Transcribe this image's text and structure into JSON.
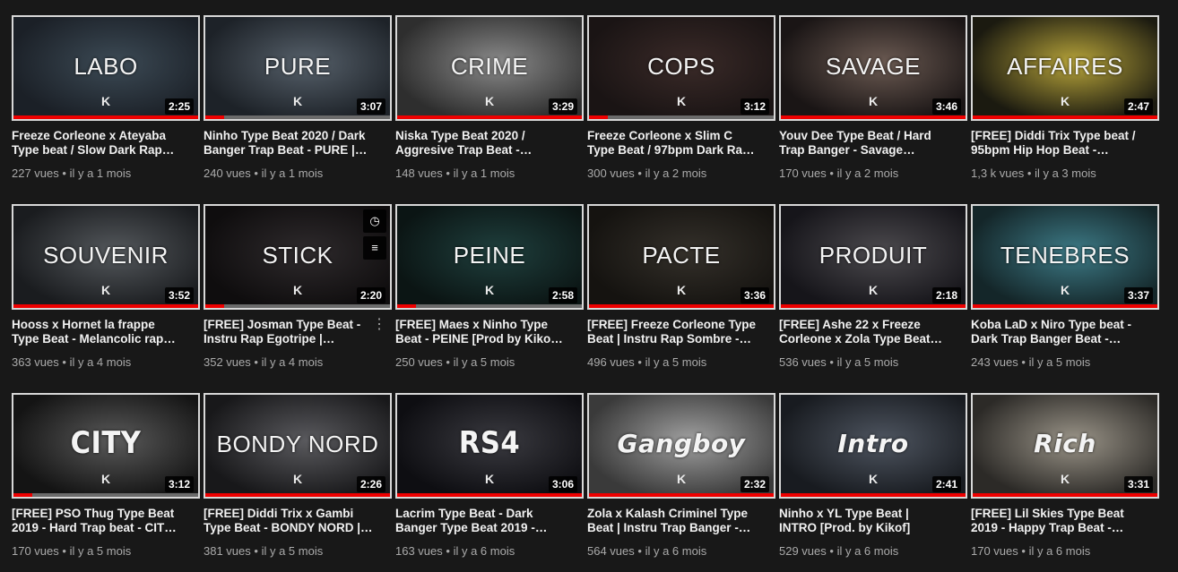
{
  "videos": [
    {
      "thumb_text": "LABO",
      "duration": "2:25",
      "title": "Freeze Corleone x Ateyaba Type beat / Slow Dark Rap…",
      "views": "227 vues",
      "age": "il y a 1 mois",
      "progress": 1.0,
      "thumb_style": "thin"
    },
    {
      "thumb_text": "PURE",
      "duration": "3:07",
      "title": "Ninho Type Beat 2020 / Dark Banger Trap Beat - PURE |…",
      "views": "240 vues",
      "age": "il y a 1 mois",
      "progress": 0.1,
      "thumb_style": "thin"
    },
    {
      "thumb_text": "CRIME",
      "duration": "3:29",
      "title": "Niska Type Beat 2020 / Aggresive Trap Beat - CRIM…",
      "views": "148 vues",
      "age": "il y a 1 mois",
      "progress": 1.0,
      "thumb_style": "thin"
    },
    {
      "thumb_text": "COPS",
      "duration": "3:12",
      "title": "Freeze Corleone x Slim C Type Beat / 97bpm Dark Ra…",
      "views": "300 vues",
      "age": "il y a 2 mois",
      "progress": 0.1,
      "thumb_style": "thin"
    },
    {
      "thumb_text": "SAVAGE",
      "duration": "3:46",
      "title": "Youv Dee Type Beat / Hard Trap Banger - Savage [Prod…",
      "views": "170 vues",
      "age": "il y a 2 mois",
      "progress": 1.0,
      "thumb_style": "thin"
    },
    {
      "thumb_text": "AFFAIRES",
      "duration": "2:47",
      "title": "[FREE] Diddi Trix Type beat / 95bpm Hip Hop Beat -…",
      "views": "1,3 k vues",
      "age": "il y a 3 mois",
      "progress": 1.0,
      "thumb_style": "thin"
    },
    {
      "thumb_text": "SOUVENIR",
      "duration": "3:52",
      "title": "Hooss x Hornet la frappe Type Beat - Melancolic rap…",
      "views": "363 vues",
      "age": "il y a 4 mois",
      "progress": 1.0,
      "thumb_style": "thin"
    },
    {
      "thumb_text": "STICK",
      "duration": "2:20",
      "title": "[FREE] Josman Type Beat - Instru Rap Egotripe | STICK…",
      "views": "352 vues",
      "age": "il y a 4 mois",
      "progress": 0.1,
      "thumb_style": "thin",
      "hovered": true
    },
    {
      "thumb_text": "PEINE",
      "duration": "2:58",
      "title": "[FREE] Maes x Ninho Type Beat - PEINE [Prod by Kikof …",
      "views": "250 vues",
      "age": "il y a 5 mois",
      "progress": 0.1,
      "thumb_style": "thin"
    },
    {
      "thumb_text": "PACTE",
      "duration": "3:36",
      "title": "[FREE] Freeze Corleone Type Beat | Instru Rap Sombre -…",
      "views": "496 vues",
      "age": "il y a 5 mois",
      "progress": 1.0,
      "thumb_style": "thin"
    },
    {
      "thumb_text": "PRODUIT",
      "duration": "2:18",
      "title": "[FREE] Ashe 22 x Freeze Corleone x Zola Type Beat -…",
      "views": "536 vues",
      "age": "il y a 5 mois",
      "progress": 1.0,
      "thumb_style": "thin"
    },
    {
      "thumb_text": "TENEBRES",
      "duration": "3:37",
      "title": "Koba LaD x Niro Type beat - Dark Trap Banger Beat -…",
      "views": "243 vues",
      "age": "il y a 5 mois",
      "progress": 1.0,
      "thumb_style": "thin"
    },
    {
      "thumb_text": "CITY",
      "duration": "3:12",
      "title": "[FREE] PSO Thug Type Beat 2019 - Hard Trap beat - CIT…",
      "views": "170 vues",
      "age": "il y a 5 mois",
      "progress": 0.1,
      "thumb_style": "bold"
    },
    {
      "thumb_text": "BONDY NORD",
      "duration": "2:26",
      "title": "[FREE] Diddi Trix x Gambi Type Beat - BONDY NORD |…",
      "views": "381 vues",
      "age": "il y a 5 mois",
      "progress": 1.0,
      "thumb_style": "thin"
    },
    {
      "thumb_text": "RS4",
      "duration": "3:06",
      "title": "Lacrim Type Beat - Dark Banger Type Beat 2019 - RS…",
      "views": "163 vues",
      "age": "il y a 6 mois",
      "progress": 1.0,
      "thumb_style": "bold"
    },
    {
      "thumb_text": "Gangboy",
      "duration": "2:32",
      "title": "Zola x Kalash Criminel Type Beat | Instru Trap Banger -…",
      "views": "564 vues",
      "age": "il y a 6 mois",
      "progress": 1.0,
      "thumb_style": "italic"
    },
    {
      "thumb_text": "Intro",
      "duration": "2:41",
      "title": "Ninho x YL Type Beat | INTRO [Prod. by Kikof]",
      "views": "529 vues",
      "age": "il y a 6 mois",
      "progress": 1.0,
      "thumb_style": "italic"
    },
    {
      "thumb_text": "Rich",
      "duration": "3:31",
      "title": "[FREE] Lil Skies Type Beat 2019 - Happy Trap Beat -…",
      "views": "170 vues",
      "age": "il y a 6 mois",
      "progress": 1.0,
      "thumb_style": "italic"
    }
  ],
  "meta_separator": "•",
  "logo_glyph": "K",
  "hover_icons": {
    "watch_later": "clock-icon",
    "add_to_queue": "queue-icon",
    "more": "more-vert-icon"
  },
  "colors": {
    "background": "#181818",
    "progress_watched": "#ee0000",
    "progress_track": "#6b6b6b",
    "title": "#f1f1f1",
    "meta": "#aaaaaa"
  }
}
